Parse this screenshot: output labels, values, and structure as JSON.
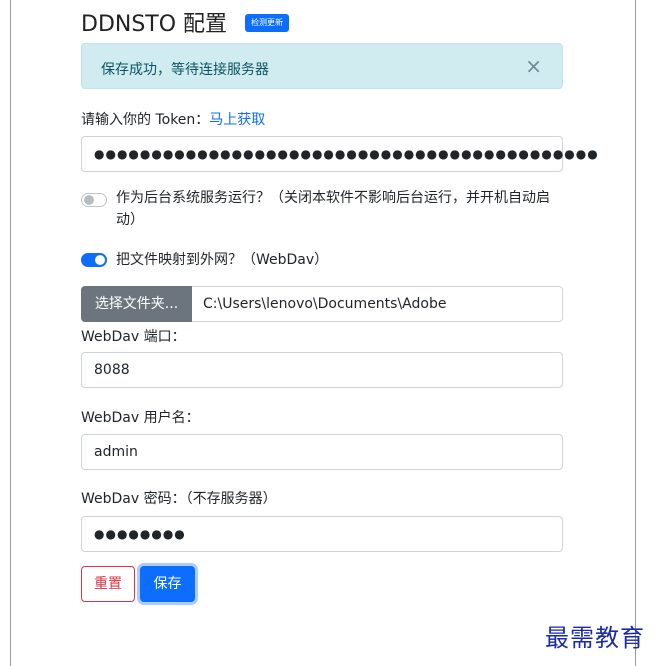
{
  "header": {
    "title": "DDNSTO 配置",
    "check_update_badge": "检测更新"
  },
  "alert": {
    "message": "保存成功，等待连接服务器",
    "close_glyph": "×"
  },
  "token": {
    "label": "请输入你的 Token：",
    "link": "马上获取",
    "masked_value": "●●●●●●●●●●●●●●●●●●●●●●●●●●●●●●●●●●●●●●●●●●●●"
  },
  "background_service": {
    "enabled": false,
    "label": "作为后台系统服务运行？（关闭本软件不影响后台运行，并开机自动启动）"
  },
  "webdav_toggle": {
    "enabled": true,
    "label": "把文件映射到外网？（WebDav）"
  },
  "file_picker": {
    "button_label": "选择文件夹...",
    "path": "C:\\Users\\lenovo\\Documents\\Adobe"
  },
  "webdav_port": {
    "label": "WebDav 端口：",
    "value": "8088"
  },
  "webdav_username": {
    "label": "WebDav 用户名：",
    "value": "admin"
  },
  "webdav_password": {
    "label": "WebDav 密码：（不存服务器）",
    "masked_value": "●●●●●●●●"
  },
  "actions": {
    "reset_label": "重置",
    "save_label": "保存"
  },
  "watermark": {
    "text": "最需教育"
  },
  "colors": {
    "primary": "#0d6efd",
    "danger": "#dc3545",
    "alert_bg": "#d1ecf1",
    "secondary": "#6c757d"
  }
}
